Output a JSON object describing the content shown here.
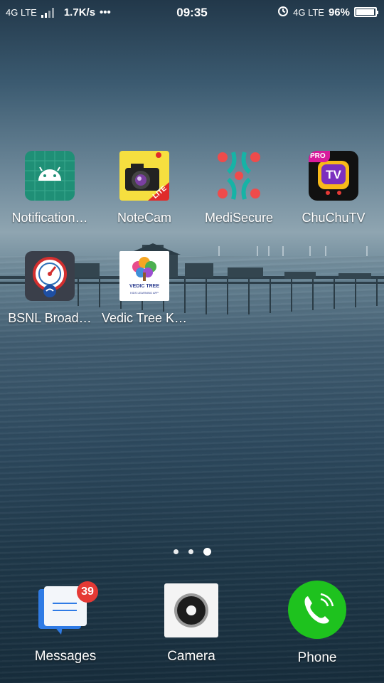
{
  "status_bar": {
    "network_left": "4G LTE",
    "speed": "1.7K/s",
    "more": "•••",
    "time": "09:35",
    "network_right": "4G LTE",
    "battery": "96%",
    "battery_level": 0.96
  },
  "apps": [
    {
      "label": "Notification…",
      "icon": "android-icon"
    },
    {
      "label": "NoteCam",
      "icon": "camera-lite-icon"
    },
    {
      "label": "MediSecure",
      "icon": "medisecure-icon"
    },
    {
      "label": "ChuChuTV",
      "icon": "tv-pro-icon"
    },
    {
      "label": "BSNL Broad…",
      "icon": "speedometer-icon"
    },
    {
      "label": "Vedic Tree K…",
      "icon": "vedic-tree-icon",
      "icon_text": "VEDIC TREE",
      "icon_subtext": "KIDS LEARNING APP"
    }
  ],
  "page_indicator": {
    "count": 3,
    "active": 3
  },
  "dock": [
    {
      "label": "Messages",
      "icon": "messages-icon",
      "badge": "39"
    },
    {
      "label": "Camera",
      "icon": "camera-icon"
    },
    {
      "label": "Phone",
      "icon": "phone-icon"
    }
  ],
  "chuchutv_text": {
    "pro": "PRO",
    "tv": "TV"
  },
  "notecam_text": {
    "lite": "LITE"
  },
  "colors": {
    "android_bg": "#1f8f76",
    "notecam_bg": "#f6df3f",
    "medisecure_red": "#ef4b4b",
    "medisecure_teal": "#16b3a6",
    "phone_green": "#1ec21e",
    "badge_red": "#e53935"
  }
}
